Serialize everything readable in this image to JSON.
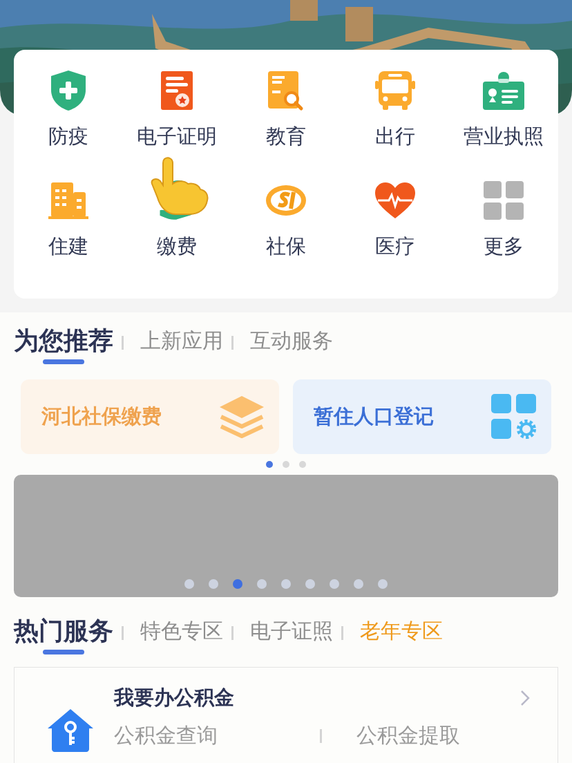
{
  "services": [
    {
      "label": "防疫",
      "kind": "shield"
    },
    {
      "label": "电子证明",
      "kind": "certificate"
    },
    {
      "label": "教育",
      "kind": "education"
    },
    {
      "label": "出行",
      "kind": "bus"
    },
    {
      "label": "营业执照",
      "kind": "license"
    },
    {
      "label": "住建",
      "kind": "building"
    },
    {
      "label": "缴费",
      "kind": "payment"
    },
    {
      "label": "社保",
      "kind": "social"
    },
    {
      "label": "医疗",
      "kind": "heart"
    },
    {
      "label": "更多",
      "kind": "more"
    }
  ],
  "recommend_tabs": [
    {
      "label": "为您推荐",
      "selected": true
    },
    {
      "label": "上新应用",
      "selected": false
    },
    {
      "label": "互动服务",
      "selected": false
    }
  ],
  "recommend_cards": [
    {
      "title": "河北社保缴费",
      "kind": "layers"
    },
    {
      "title": "暂住人口登记",
      "kind": "apps"
    }
  ],
  "recommend_pager": [
    {
      "selected": true
    },
    {
      "selected": false
    },
    {
      "selected": false
    }
  ],
  "banner_pager": [
    {
      "selected": false
    },
    {
      "selected": false
    },
    {
      "selected": true
    },
    {
      "selected": false
    },
    {
      "selected": false
    },
    {
      "selected": false
    },
    {
      "selected": false
    },
    {
      "selected": false
    },
    {
      "selected": false
    }
  ],
  "hot_tabs": [
    {
      "label": "热门服务",
      "selected": true,
      "highlighted": false
    },
    {
      "label": "特色专区",
      "selected": false,
      "highlighted": false
    },
    {
      "label": "电子证照",
      "selected": false,
      "highlighted": false
    },
    {
      "label": "老年专区",
      "selected": false,
      "highlighted": true
    }
  ],
  "service_card": {
    "title": "我要办公积金",
    "links": [
      "公积金查询",
      "公积金提取"
    ]
  }
}
